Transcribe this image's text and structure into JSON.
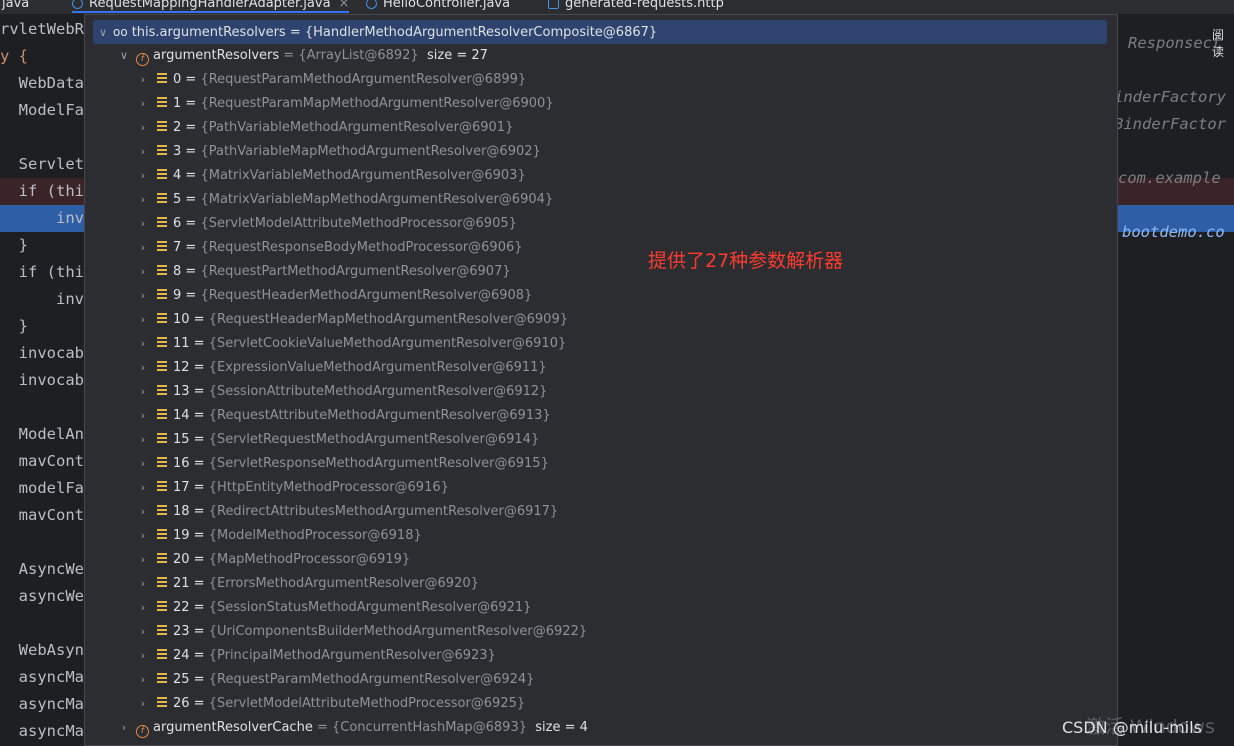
{
  "tabs": [
    {
      "label": "java"
    },
    {
      "label": "RequestMappingHandlerAdapter.java",
      "close": "×"
    },
    {
      "label": "HelloController.java"
    },
    {
      "label": "generated-requests.http"
    }
  ],
  "code_lines": [
    "rvletWebR",
    "y {",
    "  WebData",
    "  ModelFa",
    "",
    "  Servlet",
    "  if (thi",
    "      inv",
    "  }",
    "  if (thi",
    "      inv",
    "  }",
    "  invocab",
    "  invocab",
    "",
    "  ModelAn",
    "  mavCont",
    "  modelFa",
    "  mavCont",
    "",
    "  AsyncWe",
    "  asyncWe",
    "",
    "  WebAsyn",
    "  asyncMa",
    "  asyncMa",
    "  asyncMa"
  ],
  "right_notes": [
    "Responsect",
    "inderFactory",
    "BinderFactor",
    "com.example",
    "bootdemo.co"
  ],
  "side_label": "阅读",
  "debugger": {
    "root": {
      "name": "this.argumentResolvers",
      "value": "{HandlerMethodArgumentResolverComposite@6867}"
    },
    "field": {
      "icon": "f",
      "name": "argumentResolvers",
      "value": "{ArrayList@6892}",
      "size": "size = 27"
    },
    "items": [
      {
        "index": "0",
        "value": "{RequestParamMethodArgumentResolver@6899}"
      },
      {
        "index": "1",
        "value": "{RequestParamMapMethodArgumentResolver@6900}"
      },
      {
        "index": "2",
        "value": "{PathVariableMethodArgumentResolver@6901}"
      },
      {
        "index": "3",
        "value": "{PathVariableMapMethodArgumentResolver@6902}"
      },
      {
        "index": "4",
        "value": "{MatrixVariableMethodArgumentResolver@6903}"
      },
      {
        "index": "5",
        "value": "{MatrixVariableMapMethodArgumentResolver@6904}"
      },
      {
        "index": "6",
        "value": "{ServletModelAttributeMethodProcessor@6905}"
      },
      {
        "index": "7",
        "value": "{RequestResponseBodyMethodProcessor@6906}"
      },
      {
        "index": "8",
        "value": "{RequestPartMethodArgumentResolver@6907}"
      },
      {
        "index": "9",
        "value": "{RequestHeaderMethodArgumentResolver@6908}"
      },
      {
        "index": "10",
        "value": "{RequestHeaderMapMethodArgumentResolver@6909}"
      },
      {
        "index": "11",
        "value": "{ServletCookieValueMethodArgumentResolver@6910}"
      },
      {
        "index": "12",
        "value": "{ExpressionValueMethodArgumentResolver@6911}"
      },
      {
        "index": "13",
        "value": "{SessionAttributeMethodArgumentResolver@6912}"
      },
      {
        "index": "14",
        "value": "{RequestAttributeMethodArgumentResolver@6913}"
      },
      {
        "index": "15",
        "value": "{ServletRequestMethodArgumentResolver@6914}"
      },
      {
        "index": "16",
        "value": "{ServletResponseMethodArgumentResolver@6915}"
      },
      {
        "index": "17",
        "value": "{HttpEntityMethodProcessor@6916}"
      },
      {
        "index": "18",
        "value": "{RedirectAttributesMethodArgumentResolver@6917}"
      },
      {
        "index": "19",
        "value": "{ModelMethodProcessor@6918}"
      },
      {
        "index": "20",
        "value": "{MapMethodProcessor@6919}"
      },
      {
        "index": "21",
        "value": "{ErrorsMethodArgumentResolver@6920}"
      },
      {
        "index": "22",
        "value": "{SessionStatusMethodArgumentResolver@6921}"
      },
      {
        "index": "23",
        "value": "{UriComponentsBuilderMethodArgumentResolver@6922}"
      },
      {
        "index": "24",
        "value": "{PrincipalMethodArgumentResolver@6923}"
      },
      {
        "index": "25",
        "value": "{RequestParamMethodArgumentResolver@6924}"
      },
      {
        "index": "26",
        "value": "{ServletModelAttributeMethodProcessor@6925}"
      }
    ],
    "cache": {
      "icon": "f",
      "name": "argumentResolverCache",
      "value": "{ConcurrentHashMap@6893}",
      "size": "size = 4"
    }
  },
  "annotation": "提供了27种参数解析器",
  "watermark": "CSDN @milu-mils",
  "watermark_bg": "激活 Windows",
  "colors": {
    "annotation": "#ff3b30",
    "selection": "#2e436e",
    "bg": "#1e1f22",
    "popup_bg": "#2b2d30"
  }
}
